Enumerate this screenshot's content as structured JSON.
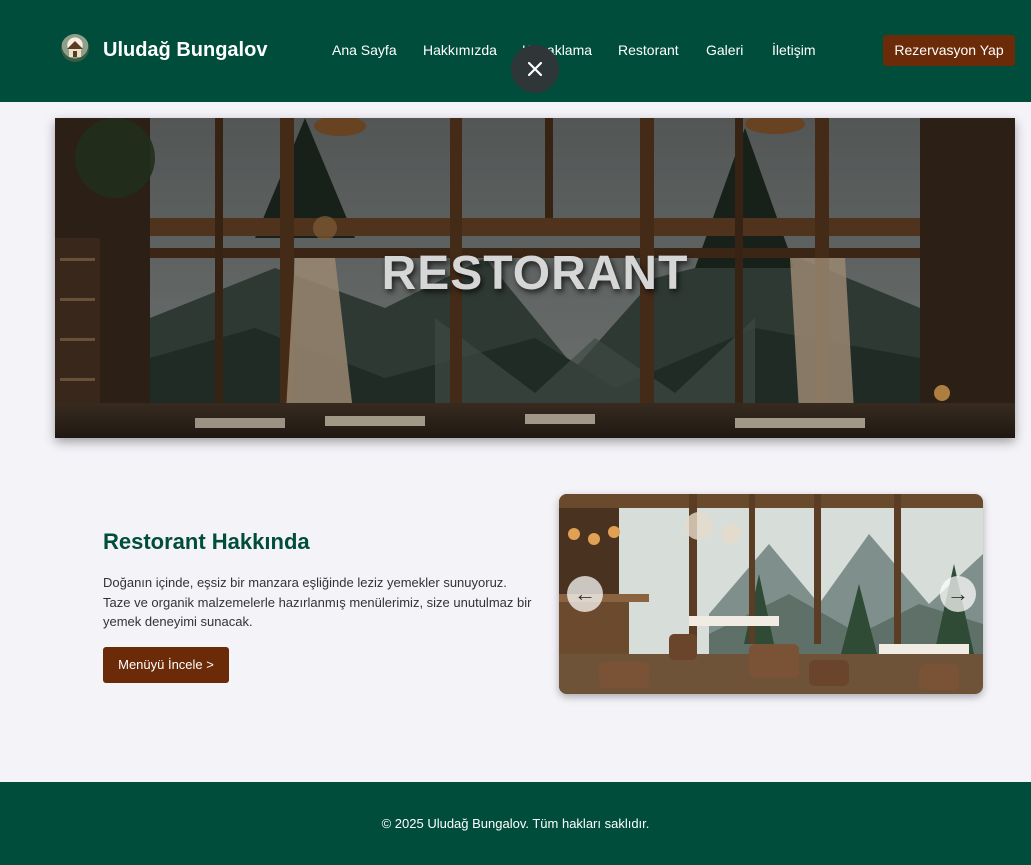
{
  "header": {
    "brand": "Uludağ Bungalov",
    "logo_icon": "bungalow-logo-icon",
    "nav": [
      "Ana Sayfa",
      "Hakkımızda",
      "Konaklama",
      "Restorant",
      "Galeri",
      "İletişim"
    ],
    "reserve_label": "Rezervasyon Yap",
    "close_icon": "close-icon"
  },
  "hero": {
    "title": "RESTORANT"
  },
  "about": {
    "title": "Restorant Hakkında",
    "text": "Doğanın içinde, eşsiz bir manzara eşliğinde leziz yemekler sunuyoruz. Taze ve organik malzemelerle hazırlanmış menülerimiz, size unutulmaz bir yemek deneyimi sunacak.",
    "button_label": "Menüyü İncele >"
  },
  "carousel": {
    "prev": "←",
    "next": "→"
  },
  "footer": {
    "text": "© 2025 Uludağ Bungalov. Tüm hakları saklıdır."
  },
  "colors": {
    "header_bg": "#004d3b",
    "accent_button": "#6b2a08",
    "page_bg": "#f4f3f8",
    "title_green": "#004d3b"
  }
}
